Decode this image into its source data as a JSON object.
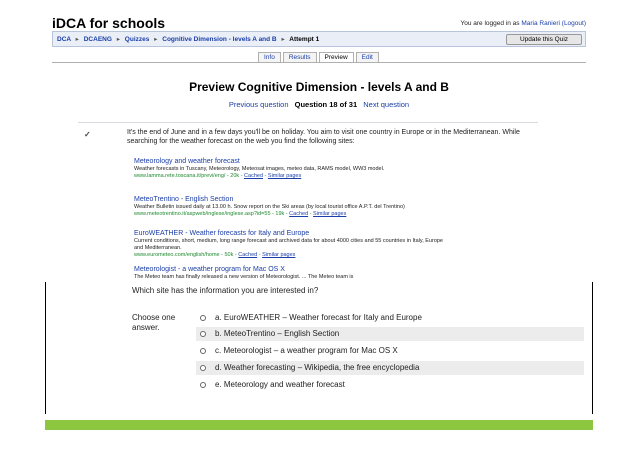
{
  "site": {
    "title": "iDCA for schools",
    "logged_in_text": "You are logged in as",
    "user_name": "Maria Ranieri",
    "logout": "(Logout)"
  },
  "breadcrumb": {
    "items": [
      "DCA",
      "DCAENG",
      "Quizzes",
      "Cognitive Dimension - levels A and B"
    ],
    "current": "Attempt 1",
    "separator": "▸"
  },
  "update_button": "Update this Quiz",
  "tabs": [
    "Info",
    "Results",
    "Preview",
    "Edit"
  ],
  "page_title": "Preview Cognitive Dimension - levels A and B",
  "question_nav": {
    "prev": "Previous question",
    "current": "Question 18 of 31",
    "next": "Next question"
  },
  "question": {
    "marker": "✓",
    "intro": "It's the end of June and in a few days you'll be on holiday. You aim to visit one country in Europe or in the Mediterranean. While searching for the weather forecast on the web you find the following sites:",
    "results": [
      {
        "title": "Meteorology and weather forecast",
        "snippet": "Weather forecasts in Tuscany, Meteorology, Meteosat images, meteo data, RAMS model, WW3 model.",
        "url": "www.lamma.rete.toscana.it/previ/eng/ - 20k - ",
        "cached": "Cached",
        "similar": "Similar pages"
      },
      {
        "title": "MeteoTrentino - English Section",
        "snippet": "Weather Bulletin issued daily at 13.00 h. Snow report on the Ski areas (by local tourist office A.P.T. del Trentino)",
        "url": "www.meteotrentino.it/aspweb/inglese/inglese.asp?id=55 - 19k - ",
        "cached": "Cached",
        "similar": "Similar pages"
      },
      {
        "title": "EuroWEATHER - Weather forecasts for Italy and Europe",
        "snippet": "Current conditions, short, medium, long range forecast and archived data for about 4000 cities and 55 countries in Italy, Europe and Mediterranean.",
        "url": "www.eurometeo.com/english/home - 50k - ",
        "cached": "Cached",
        "similar": "Similar pages"
      },
      {
        "title": "Meteorologist - a weather program for Mac OS X",
        "snippet": "The Meteo team has finally released a new version of Meteorologist. ... The Meteo team is",
        "url": "",
        "cached": "",
        "similar": ""
      }
    ],
    "prompt": "Which site has the information you are interested in?",
    "choose_label": "Choose one answer.",
    "options": [
      "a. EuroWEATHER – Weather forecast for Italy and Europe",
      "b. MeteoTrentino – English Section",
      "c. Meteorologist – a weather program for Mac OS X",
      "d. Weather forecasting – Wikipedia, the free encyclopedia",
      "e. Meteorology and weather forecast"
    ]
  },
  "colors": {
    "link": "#1a3ea8",
    "url_green": "#1d8a2e",
    "navbar_bg": "#e9eef7",
    "option_shade": "#ececec",
    "footer_bar": "#8dc63f"
  }
}
